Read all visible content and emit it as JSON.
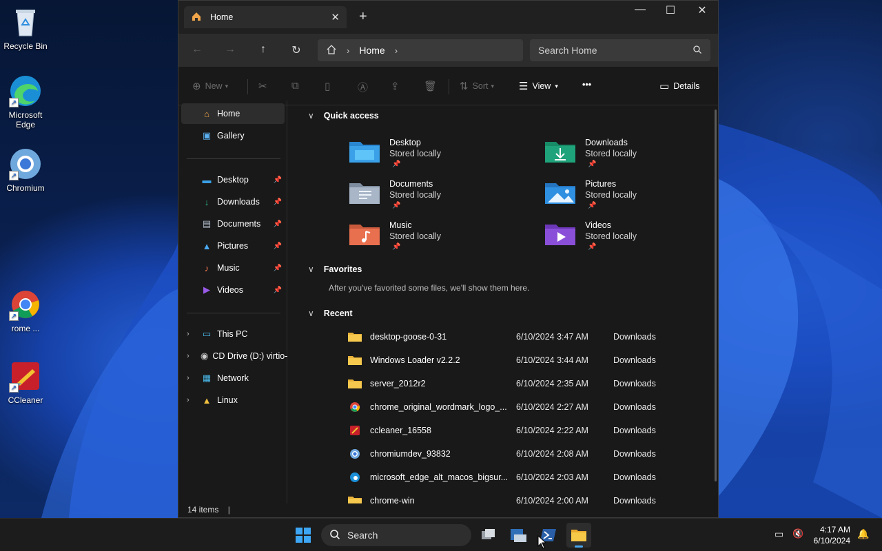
{
  "desktop": {
    "icons": [
      {
        "label": "Recycle Bin"
      },
      {
        "label": "Microsoft Edge"
      },
      {
        "label": "Chromium"
      },
      {
        "label": "rome ..."
      },
      {
        "label": "CCleaner"
      }
    ]
  },
  "window": {
    "tab_title": "Home",
    "new_tab_glyph": "+",
    "controls": {
      "minimize": "—",
      "maximize": "☐",
      "close": "✕"
    },
    "address": {
      "crumb": "Home"
    },
    "search_placeholder": "Search Home",
    "commands": {
      "new": "New",
      "sort": "Sort",
      "view": "View",
      "more": "•••",
      "details": "Details"
    },
    "sidebar": {
      "top": [
        {
          "label": "Home",
          "icon": "home-icon",
          "selected": true
        },
        {
          "label": "Gallery",
          "icon": "gallery-icon"
        }
      ],
      "pinned": [
        {
          "label": "Desktop",
          "icon": "desktop-folder-icon"
        },
        {
          "label": "Downloads",
          "icon": "download-icon"
        },
        {
          "label": "Documents",
          "icon": "documents-icon"
        },
        {
          "label": "Pictures",
          "icon": "pictures-icon"
        },
        {
          "label": "Music",
          "icon": "music-icon"
        },
        {
          "label": "Videos",
          "icon": "videos-icon"
        }
      ],
      "drives": [
        {
          "label": "This PC",
          "icon": "pc-icon"
        },
        {
          "label": "CD Drive (D:) virtio-",
          "icon": "cd-drive-icon"
        },
        {
          "label": "Network",
          "icon": "network-icon"
        },
        {
          "label": "Linux",
          "icon": "linux-icon"
        }
      ]
    },
    "quick_access": {
      "title": "Quick access",
      "items": [
        {
          "name": "Desktop",
          "status": "Stored locally",
          "color": "#3aa0e8"
        },
        {
          "name": "Downloads",
          "status": "Stored locally",
          "color": "#1fa37a"
        },
        {
          "name": "Documents",
          "status": "Stored locally",
          "color": "#9aa8b8"
        },
        {
          "name": "Pictures",
          "status": "Stored locally",
          "color": "#2f8fe0"
        },
        {
          "name": "Music",
          "status": "Stored locally",
          "color": "#e8704f"
        },
        {
          "name": "Videos",
          "status": "Stored locally",
          "color": "#8a4fd8"
        }
      ]
    },
    "favorites": {
      "title": "Favorites",
      "empty_note": "After you've favorited some files, we'll show them here."
    },
    "recent": {
      "title": "Recent",
      "items": [
        {
          "name": "desktop-goose-0-31",
          "date": "6/10/2024 3:47 AM",
          "location": "Downloads",
          "icon": "folder-icon"
        },
        {
          "name": "Windows Loader v2.2.2",
          "date": "6/10/2024 3:44 AM",
          "location": "Downloads",
          "icon": "folder-icon"
        },
        {
          "name": "server_2012r2",
          "date": "6/10/2024 2:35 AM",
          "location": "Downloads",
          "icon": "folder-icon"
        },
        {
          "name": "chrome_original_wordmark_logo_...",
          "date": "6/10/2024 2:27 AM",
          "location": "Downloads",
          "icon": "chrome-icon"
        },
        {
          "name": "ccleaner_16558",
          "date": "6/10/2024 2:22 AM",
          "location": "Downloads",
          "icon": "ccleaner-icon"
        },
        {
          "name": "chromiumdev_93832",
          "date": "6/10/2024 2:08 AM",
          "location": "Downloads",
          "icon": "chromium-icon"
        },
        {
          "name": "microsoft_edge_alt_macos_bigsur...",
          "date": "6/10/2024 2:03 AM",
          "location": "Downloads",
          "icon": "edge-icon"
        },
        {
          "name": "chrome-win",
          "date": "6/10/2024 2:00 AM",
          "location": "Downloads",
          "icon": "folder-icon"
        }
      ]
    },
    "status": "14 items"
  },
  "taskbar": {
    "search_label": "Search",
    "time": "4:17 AM",
    "date": "6/10/2024"
  }
}
